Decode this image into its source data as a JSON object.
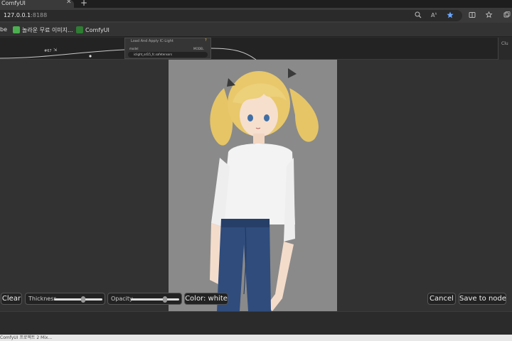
{
  "browser": {
    "tab_title": "ComfyUI",
    "tab_close_glyph": "✕",
    "new_tab_glyph": "+",
    "url_host": "127.0.0.1",
    "url_port": ":8188",
    "bookmarks": [
      {
        "label": "be"
      },
      {
        "label": "놀라운 무료 이미지..."
      },
      {
        "label": "ComfyUI"
      }
    ]
  },
  "graph": {
    "node_title": "Load And Apply IC-Light",
    "node_input": "model",
    "node_output": "MODEL",
    "node_widget_value": "iclight_sd15_fc.safetensors",
    "node_id_badge": "#67",
    "right_panel_label": "Clu"
  },
  "mask_editor": {
    "clear_label": "Clear",
    "thickness_label": "Thickness",
    "thickness_value": 0.6,
    "opacity_label": "Opacity",
    "opacity_value": 0.7,
    "color_button_label": "Color: white",
    "cancel_label": "Cancel",
    "save_label": "Save to node"
  },
  "taskbar": {
    "text": "ComfyUI   프로젝트 2   Mix..."
  },
  "colors": {
    "canvas_bg": "#303030",
    "image_bg": "#8a8a8a",
    "hair": "#e8c86a",
    "shirt": "#f2f2f2",
    "jeans": "#2e4a78",
    "star_accent": "#6aa7ff"
  },
  "icons": [
    "zoom-icon",
    "read-aloud-icon",
    "favorite-star-icon",
    "split-screen-icon",
    "favorites-icon",
    "collections-icon"
  ]
}
